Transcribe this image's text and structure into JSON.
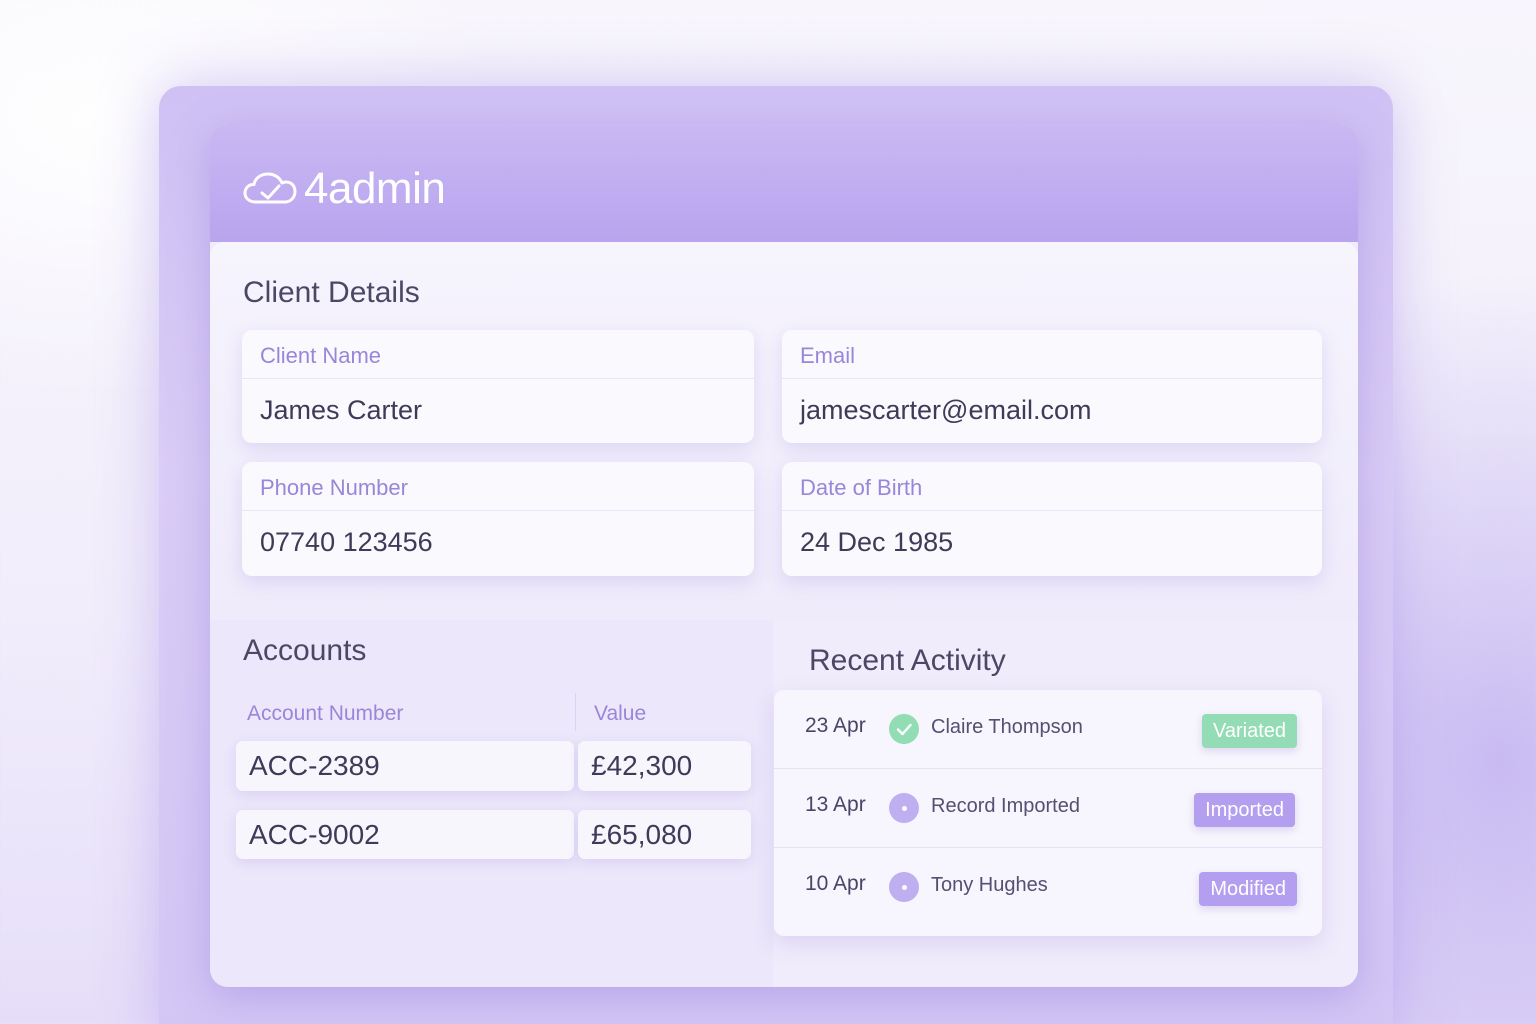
{
  "app": {
    "logo_text": "4admin",
    "logo_icon": "cloud-check-icon"
  },
  "client_details": {
    "title": "Client Details",
    "fields": {
      "name": {
        "label": "Client Name",
        "value": "James Carter"
      },
      "email": {
        "label": "Email",
        "value": "jamescarter@email.com"
      },
      "phone": {
        "label": "Phone Number",
        "value": "07740 123456"
      },
      "dob": {
        "label": "Date of Birth",
        "value": "24 Dec 1985"
      }
    }
  },
  "accounts": {
    "title": "Accounts",
    "columns": [
      "Account Number",
      "Value"
    ],
    "rows": [
      {
        "account": "ACC-2389",
        "value": "£42,300"
      },
      {
        "account": "ACC-9002",
        "value": "£65,080"
      }
    ]
  },
  "recent_activity": {
    "title": "Recent Activity",
    "items": [
      {
        "date": "23 Apr",
        "icon": "check-circle-icon",
        "name": "Claire Thompson",
        "status": "Variated",
        "status_color": "#93dcb6"
      },
      {
        "date": "13 Apr",
        "icon": "dot-circle-icon",
        "name": "Record Imported",
        "status": "Imported",
        "status_color": "#b49ef0"
      },
      {
        "date": "10 Apr",
        "icon": "dot-circle-icon",
        "name": "Tony Hughes",
        "status": "Modified",
        "status_color": "#b49ef0"
      }
    ]
  },
  "colors": {
    "accent": "#b49ef0",
    "success": "#93dcb6",
    "label": "#9a86d8"
  }
}
